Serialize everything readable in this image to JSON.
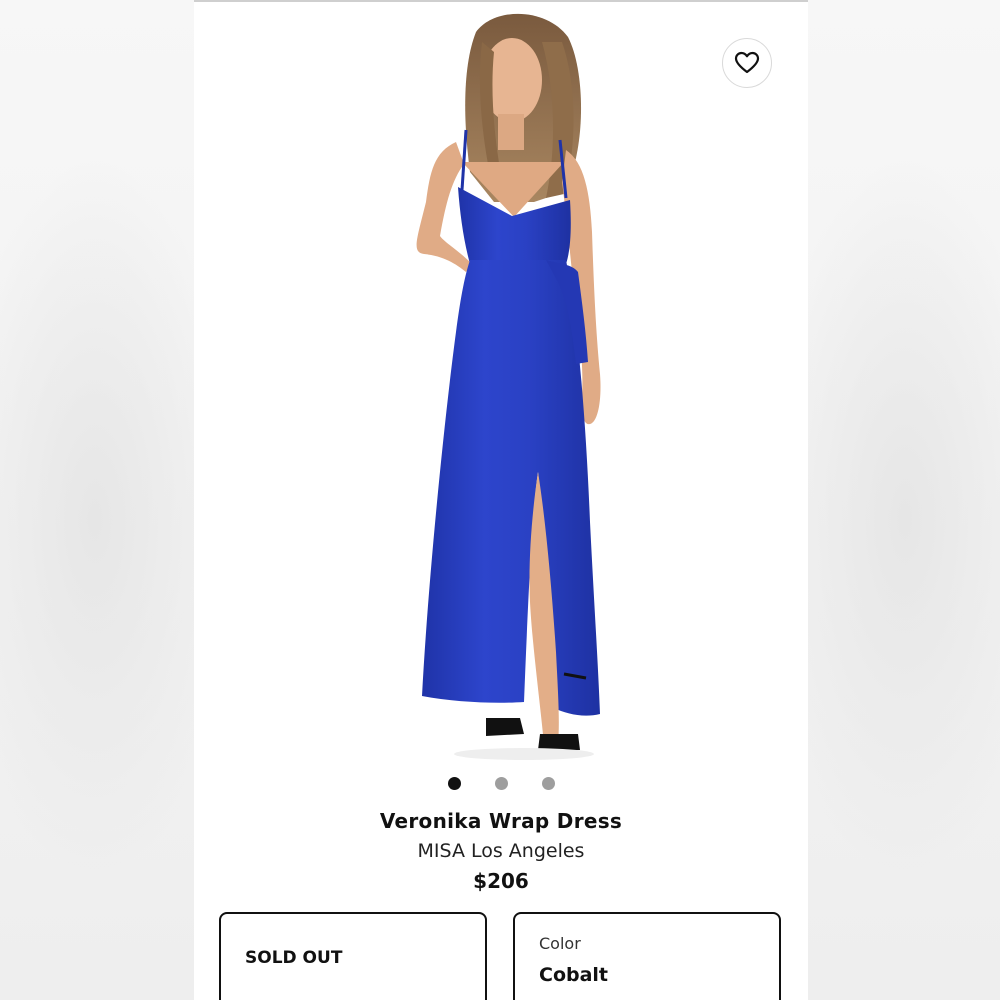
{
  "product": {
    "name": "Veronika Wrap Dress",
    "brand": "MISA Los Angeles",
    "price": "$206",
    "dress_color_hex": "#2a3fc0"
  },
  "gallery": {
    "image_count": 3,
    "active_index": 0
  },
  "favorite": {
    "icon": "heart-outline-icon"
  },
  "size_selector": {
    "status": "SOLD OUT"
  },
  "color_selector": {
    "label": "Color",
    "value": "Cobalt"
  }
}
